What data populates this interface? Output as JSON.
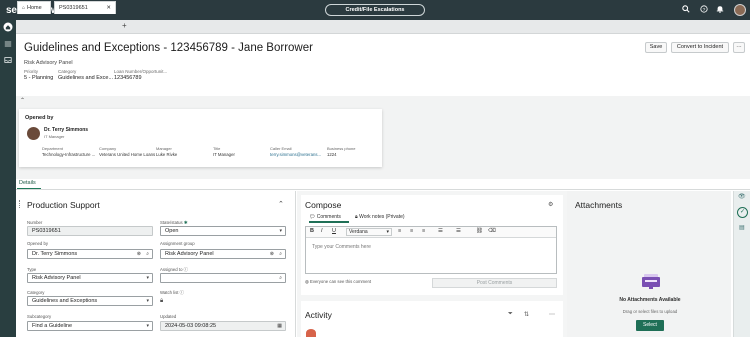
{
  "topbar": {
    "brand_prefix": "servicen",
    "brand_o": "o",
    "brand_suffix": "w",
    "context_pill": "Credit/File Escalations"
  },
  "tabs": [
    {
      "label": "Home"
    },
    {
      "label": "PS0319651"
    }
  ],
  "record": {
    "title": "Guidelines and Exceptions - 123456789 - Jane Borrower",
    "subtitle": "Risk Advisory Panel",
    "save_label": "Save",
    "convert_label": "Convert to Incident",
    "more_label": "···",
    "meta": [
      {
        "label": "Priority",
        "value": "5 - Planning"
      },
      {
        "label": "Category",
        "value": "Guidelines and Exce..."
      },
      {
        "label": "Loan Number/Opportunit...",
        "value": "123456789"
      }
    ]
  },
  "opened_by": {
    "heading": "Opened by",
    "name": "Dr. Terry Simmons",
    "role": "IT Manager",
    "fields": [
      {
        "label": "Department",
        "value": "Technology-Infrastructure ..."
      },
      {
        "label": "Company",
        "value": "Veterans United Home Loans"
      },
      {
        "label": "Manager",
        "value": "Luke Rivke"
      },
      {
        "label": "Title",
        "value": "IT Manager"
      },
      {
        "label": "Caller Email",
        "value": "terry.simmons@veterans..."
      },
      {
        "label": "Business phone",
        "value": "1224"
      }
    ]
  },
  "details_tab": "Details",
  "production_support": {
    "title": "Production Support",
    "number_label": "Number",
    "number_value": "PS0319651",
    "state_label": "State/status",
    "state_value": "Open",
    "opened_by_label": "Opened by",
    "opened_by_value": "Dr. Terry Simmons",
    "assignment_group_label": "Assignment group",
    "assignment_group_value": "Risk Advisory Panel",
    "type_label": "Type",
    "type_value": "Risk Advisory Panel",
    "assigned_to_label": "Assigned to",
    "assigned_to_value": "",
    "category_label": "Category",
    "category_value": "Guidelines and Exceptions",
    "watch_list_label": "Watch list",
    "subcategory_label": "Subcategory",
    "subcategory_value": "Find a Guideline",
    "updated_label": "Updated",
    "updated_value": "2024-05-03 09:08:25"
  },
  "compose": {
    "title": "Compose",
    "tab_comments": "Comments",
    "tab_work_notes": "Work notes (Private)",
    "font_select": "Verdana",
    "placeholder": "Type your Comments here",
    "visibility_note": "Everyone can see this comment",
    "post_label": "Post Comments"
  },
  "activity": {
    "title": "Activity"
  },
  "attachments": {
    "title": "Attachments",
    "empty_title": "No Attachments Available",
    "empty_hint": "Drag or select files to upload",
    "select_label": "Select"
  },
  "colors": {
    "topbar": "#2b3a3f",
    "accent_green": "#1f6f56",
    "brand_green": "#62d84e"
  }
}
